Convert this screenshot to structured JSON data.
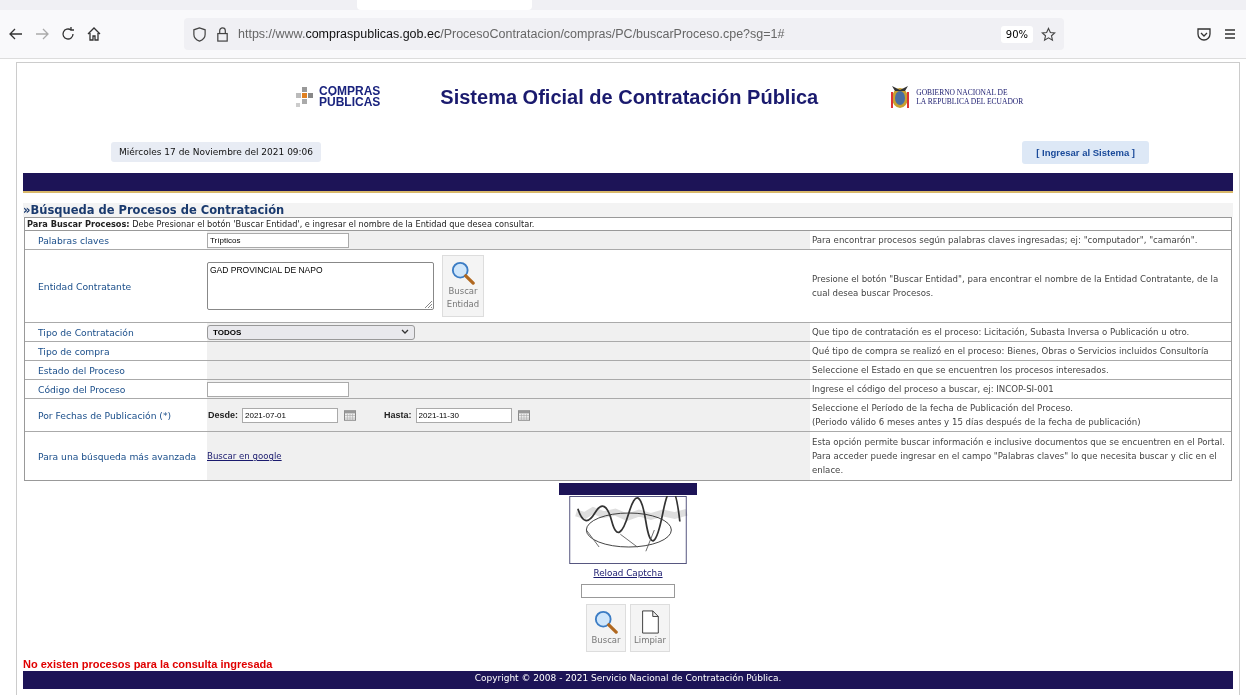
{
  "browser": {
    "url_host": "https://www.",
    "url_domain": "compraspublicas.gob.ec",
    "url_path": "/ProcesoContratacion/compras/PC/buscarProceso.cpe?sg=1#",
    "zoom": "90%"
  },
  "header": {
    "logo_line1": "COMPRAS",
    "logo_line2": "PÚBLICAS",
    "title": "Sistema Oficial de Contratación Pública",
    "gov_line1": "GOBIERNO NACIONAL DE",
    "gov_line2": "LA REPUBLICA DEL ECUADOR",
    "date": "Miércoles 17 de Noviembre del 2021 09:06",
    "login_link": "[ Ingresar al Sistema ]"
  },
  "section_title": "»Búsqueda de Procesos de Contratación",
  "instruction": "**Para Buscar Procesos:** Debe Presionar el botón 'Buscar Entidad', e ingresar el nombre de la Entidad que desea consultar.",
  "rows": [
    {
      "kind": "text",
      "label": "Palabras claves",
      "value": "Trípticos",
      "help": "Para encontrar procesos según palabras claves ingresadas; ej: \"computador\", \"camarón\"."
    },
    {
      "kind": "entity",
      "label": "Entidad Contratante",
      "value": "GAD PROVINCIAL DE NAPO",
      "button": "Buscar Entidad",
      "help": "Presione el botón \"Buscar Entidad\", para encontrar el nombre de la Entidad Contratante, de la cual desea buscar Procesos."
    },
    {
      "kind": "select",
      "label": "Tipo de Contratación",
      "value": "TODOS",
      "help": "Que tipo de contratación es el proceso: Licitación, Subasta Inversa o Publicación u otro."
    },
    {
      "kind": "empty",
      "label": "Tipo de compra",
      "help": "Qué tipo de compra se realizó en el proceso: Bienes, Obras o Servicios incluidos Consultoría"
    },
    {
      "kind": "empty",
      "label": "Estado del Proceso",
      "help": "Seleccione el Estado en que se encuentren los procesos interesados."
    },
    {
      "kind": "text",
      "label": "Código del Proceso",
      "value": "",
      "help": "Ingrese el código del proceso a buscar, ej: INCOP-SI-001"
    },
    {
      "kind": "dates",
      "label": "Por Fechas de Publicación (*)",
      "from_label": "Desde:",
      "from": "2021-07-01",
      "to_label": "Hasta:",
      "to": "2021-11-30",
      "help": "Seleccione el Período de la fecha de Publicación del Proceso.\n(Periodo válido 6 meses antes y 15 días después de la fecha de publicación)"
    },
    {
      "kind": "link",
      "label": "Para una búsqueda más avanzada",
      "link": "Buscar en google",
      "help": "Esta opción permite buscar información e inclusive documentos que se encuentren en el Portal. Para acceder puede ingresar en el campo \"Palabras claves\" lo que necesita buscar y clic en el enlace."
    }
  ],
  "captcha": {
    "reload": "Reload Captcha"
  },
  "actions": [
    "Buscar",
    "Limpiar"
  ],
  "message": "No existen procesos para la consulta ingresada",
  "footer": "Copyright © 2008 - 2021 Servicio Nacional de Contratación Pública."
}
